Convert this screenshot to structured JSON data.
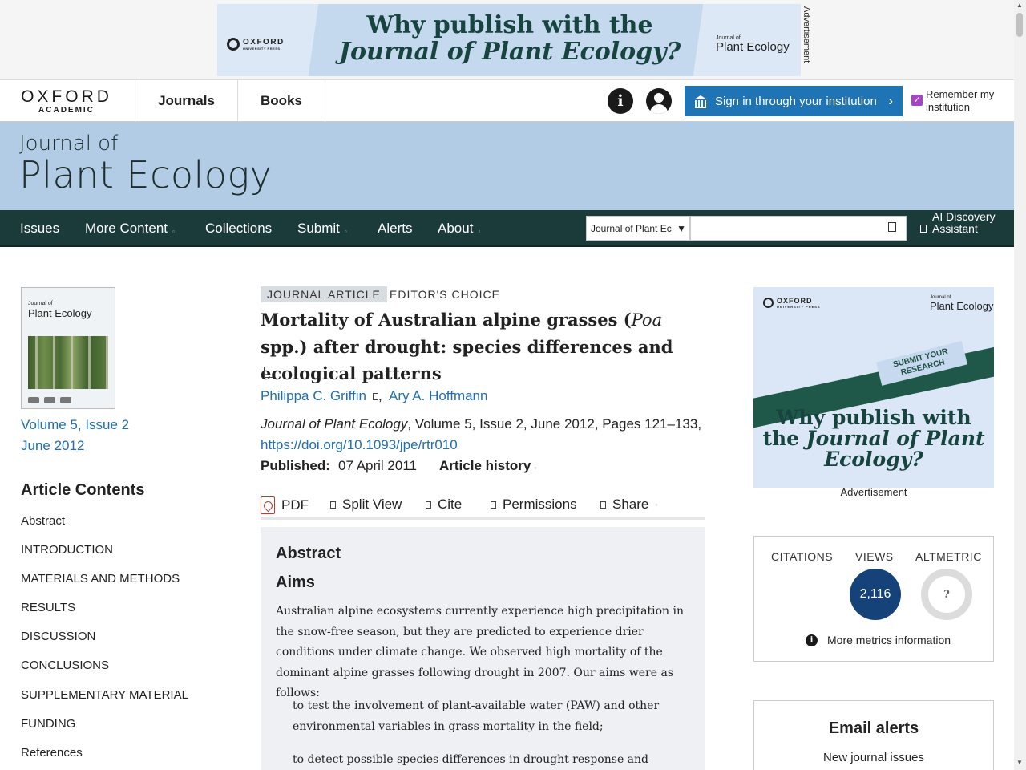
{
  "top_ad": {
    "publisher": "OXFORD",
    "publisher_sub": "UNIVERSITY PRESS",
    "headline_line1": "Why publish with the",
    "headline_line2": "Journal of Plant Ecology?",
    "journal_small": "Journal of",
    "journal_name": "Plant Ecology",
    "side_label": "Advertisement"
  },
  "header": {
    "logo_main": "OXFORD",
    "logo_sub": "ACADEMIC",
    "nav": [
      "Journals",
      "Books"
    ],
    "info_icon_glyph": "i",
    "signin_label": "Sign in through your institution",
    "signin_chevron": "›",
    "remember_label": "Remember my institution",
    "remember_checked": true,
    "accent_color": "#1f74b5"
  },
  "journal": {
    "title_line1": "Journal of",
    "title_line2": "Plant Ecology",
    "banner_color": "#b3cce5"
  },
  "main_nav": {
    "items": [
      {
        "label": "Issues",
        "has_caret": false
      },
      {
        "label": "More Content",
        "has_caret": true
      },
      {
        "label": "Collections",
        "has_caret": false
      },
      {
        "label": "Submit",
        "has_caret": true
      },
      {
        "label": "Alerts",
        "has_caret": false
      },
      {
        "label": "About",
        "has_caret": true
      }
    ],
    "search_scope": "Journal of Plant Ec",
    "search_placeholder": "",
    "ai_label": "AI Discovery Assistant",
    "bar_color": "#1b3a3a"
  },
  "sidebar": {
    "cover_journal_small": "Journal of",
    "cover_journal_name": "Plant Ecology",
    "volume_issue": "Volume 5, Issue 2",
    "issue_date": "June 2012",
    "contents_title": "Article Contents",
    "contents": [
      "Abstract",
      "INTRODUCTION",
      "MATERIALS AND METHODS",
      "RESULTS",
      "DISCUSSION",
      "CONCLUSIONS",
      "SUPPLEMENTARY MATERIAL",
      "FUNDING",
      "References"
    ]
  },
  "article": {
    "type_badge": "JOURNAL ARTICLE",
    "editors_choice": "EDITOR'S CHOICE",
    "title_part1": "Mortality of Australian alpine grasses (",
    "title_italic": "Poa",
    "title_part2": " spp.) after drought: species differences and ecological patterns",
    "authors": [
      "Philippa C. Griffin",
      "Ary A. Hoffmann"
    ],
    "author_separator": ",",
    "citation_journal": "Journal of Plant Ecology",
    "citation_rest": ", Volume 5, Issue 2, June 2012, Pages 121–133,",
    "doi": "https://doi.org/10.1093/jpe/rtr010",
    "published_label": "Published:",
    "published_date": "07 April 2011",
    "history_label": "Article history",
    "toolbar": [
      "PDF",
      "Split View",
      "Cite",
      "Permissions",
      "Share"
    ]
  },
  "abstract": {
    "heading": "Abstract",
    "aims_heading": "Aims",
    "paragraph": "Australian alpine ecosystems currently experience high precipitation in the snow-free season, but they are predicted to experience drier conditions under climate change. We observed high mortality of the dominant alpine grasses following drought in 2007. Our aims were as follows:",
    "aims": [
      "to test the involvement of plant-available water (PAW) and other environmental variables in grass mortality in the field;",
      "to detect possible species differences in drought response and"
    ]
  },
  "right_ad": {
    "publisher": "OXFORD",
    "publisher_sub": "UNIVERSITY PRESS",
    "journal_small": "Journal of",
    "journal_name": "Plant Ecology",
    "submit_text": "SUBMIT YOUR RESEARCH",
    "headline_1": "Why publish with",
    "headline_2": "the ",
    "headline_italic": "Journal of Plant Ecology?",
    "caption": "Advertisement"
  },
  "metrics": {
    "citations_label": "CITATIONS",
    "views_label": "VIEWS",
    "altmetric_label": "ALTMETRIC",
    "views_value": "2,116",
    "altmetric_value": "?",
    "more_link": "More metrics information"
  },
  "email_alerts": {
    "title": "Email alerts",
    "subtitle": "New journal issues"
  }
}
